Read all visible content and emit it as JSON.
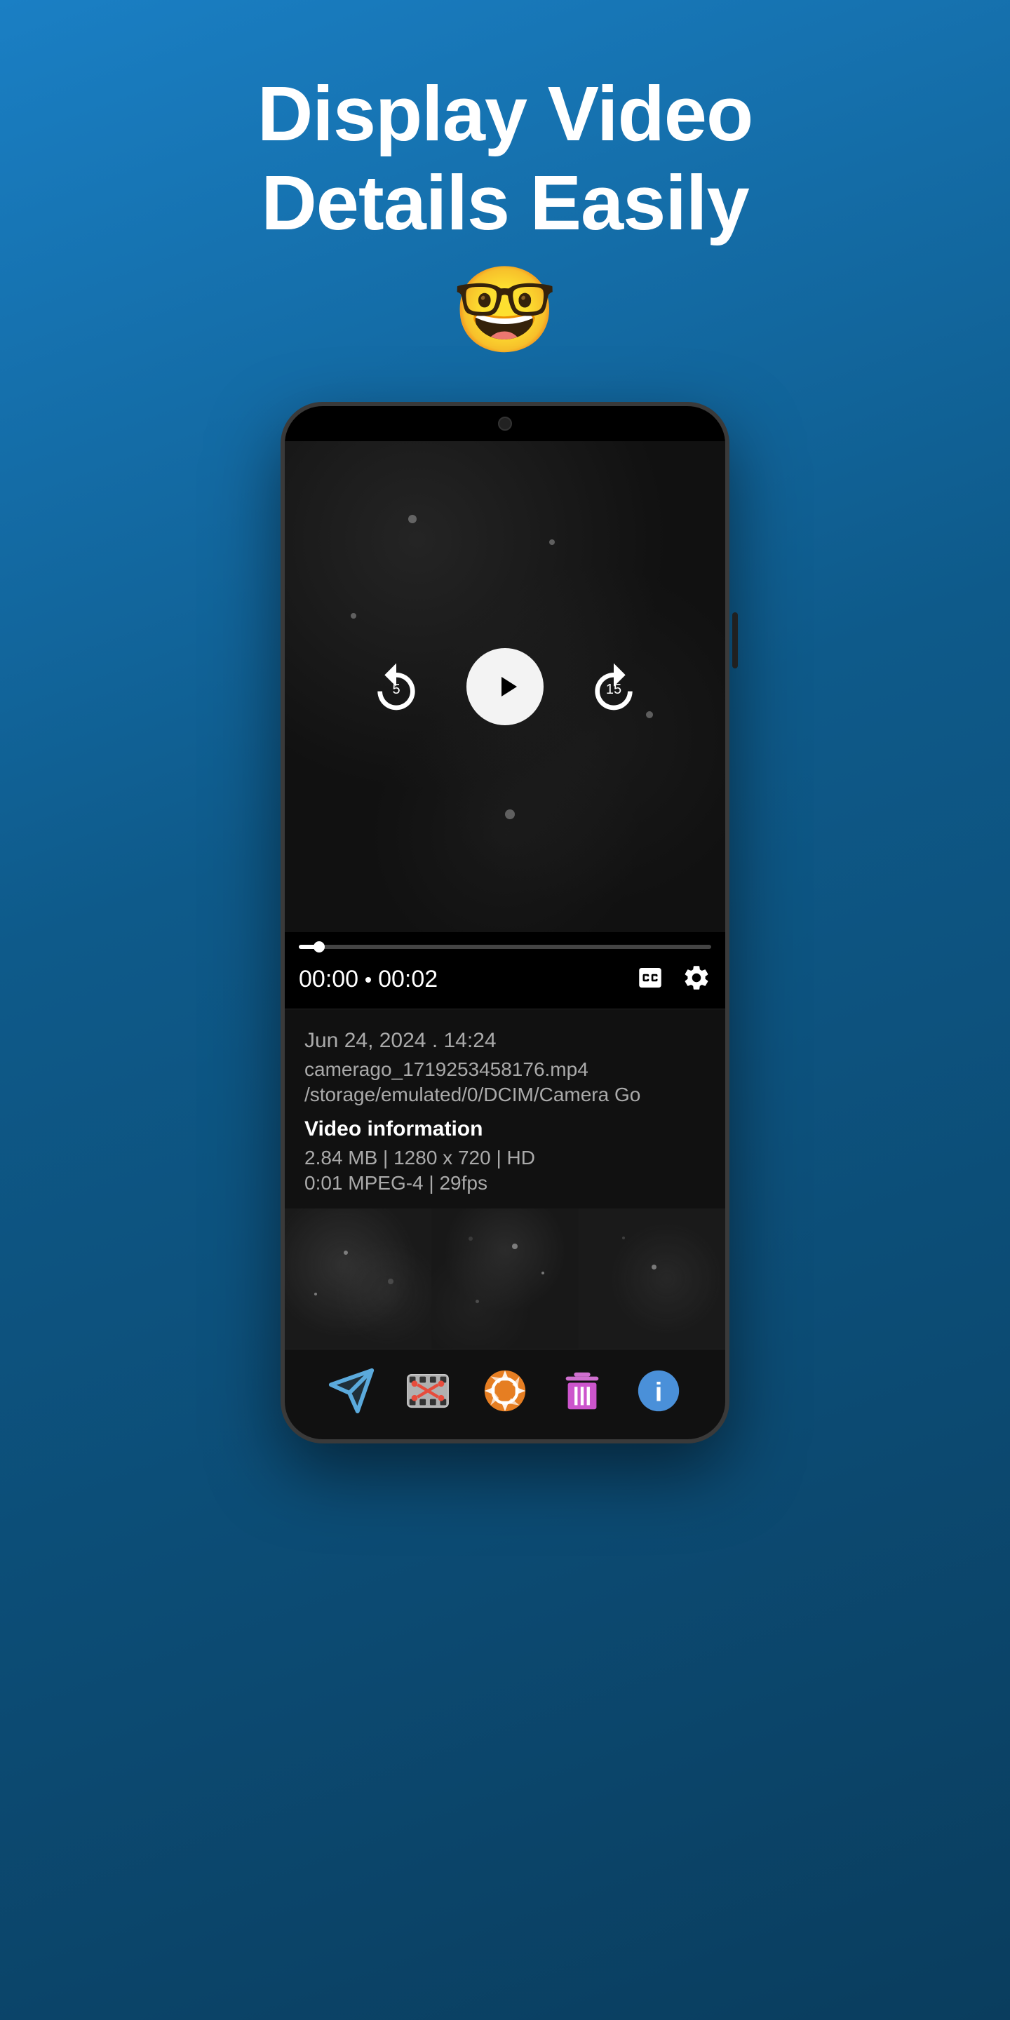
{
  "header": {
    "title_line1": "Display Video",
    "title_line2": "Details Easily",
    "emoji": "🤓"
  },
  "phone": {
    "video": {
      "current_time": "00:00",
      "total_time": "00:02",
      "progress_percent": 5
    },
    "info": {
      "date": "Jun 24, 2024 . 14:24",
      "filename": "camerago_1719253458176.mp4",
      "path": "/storage/emulated/0/DCIM/Camera Go",
      "video_info_label": "Video information",
      "size": "2.84 MB | 1280 x 720 | HD",
      "duration": "0:01 MPEG-4 | 29fps"
    },
    "nav": {
      "share_label": "Share",
      "edit_label": "Edit",
      "camera_label": "Camera",
      "trash_label": "Trash",
      "info_label": "Info"
    }
  }
}
